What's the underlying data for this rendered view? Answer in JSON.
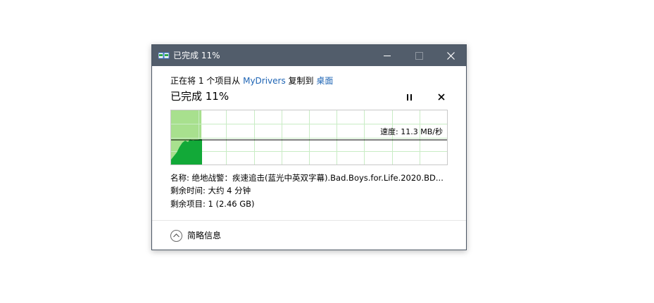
{
  "window": {
    "title": "已完成 11%",
    "icon": "file-copy-icon",
    "controls": [
      "minimize-icon",
      "maximize-icon",
      "close-icon"
    ]
  },
  "copy_info": {
    "prefix": "正在将 1 个项目从 ",
    "source": "MyDrivers",
    "middle": " 复制到 ",
    "destination": "桌面"
  },
  "progress": {
    "title": "已完成 11%",
    "percent": 11,
    "speed_label": "速度: 11.3 MB/秒"
  },
  "details": {
    "name_line": "名称: 绝地战警：疾速追击(蓝光中英双字幕).Bad.Boys.for.Life.2020.BD...",
    "time_line": "剩余时间: 大约 4 分钟",
    "items_line": "剩余项目: 1 (2.46 GB)"
  },
  "footer": {
    "toggle_label": "简略信息"
  },
  "colors": {
    "titlebar": "#525d6b",
    "progress_fill": "#a8e08e",
    "speed_area": "#12a938",
    "grid": "#c9ecc5",
    "link": "#1e64b4"
  }
}
